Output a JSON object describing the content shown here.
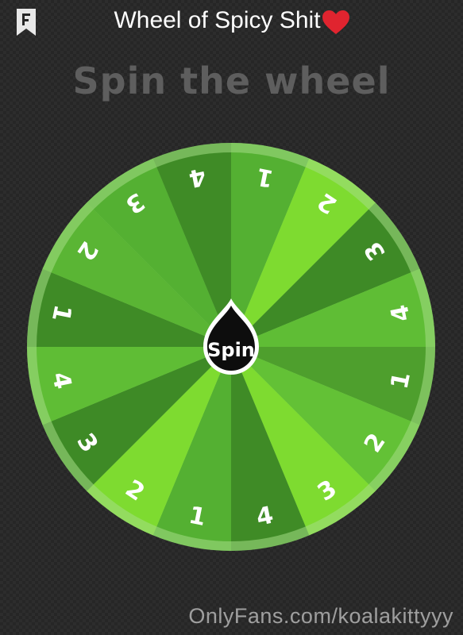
{
  "header": {
    "title": "Wheel of Spicy Shit",
    "title_emoji_icon": "red-heart-icon",
    "bookmark_icon": "bookmark-f-icon"
  },
  "subtitle": "Spin the wheel",
  "wheel": {
    "spin_label": "Spin",
    "segments": [
      {
        "label": "1",
        "color": "#54b032"
      },
      {
        "label": "2",
        "color": "#7edb30"
      },
      {
        "label": "3",
        "color": "#3e8a26"
      },
      {
        "label": "4",
        "color": "#5fbd35"
      },
      {
        "label": "1",
        "color": "#4e9f2d"
      },
      {
        "label": "2",
        "color": "#63c136"
      },
      {
        "label": "3",
        "color": "#7edb30"
      },
      {
        "label": "4",
        "color": "#3f8b26"
      },
      {
        "label": "1",
        "color": "#54b032"
      },
      {
        "label": "2",
        "color": "#7edb30"
      },
      {
        "label": "3",
        "color": "#3e8a26"
      },
      {
        "label": "4",
        "color": "#5fbd35"
      },
      {
        "label": "1",
        "color": "#3f8b26"
      },
      {
        "label": "2",
        "color": "#5ab534"
      },
      {
        "label": "3",
        "color": "#54b032"
      },
      {
        "label": "4",
        "color": "#3f8b26"
      }
    ],
    "rim_color": "#a5dd86",
    "label_color": "#ffffff",
    "spin_button_color": "#0d0d0d"
  },
  "watermark": "OnlyFans.com/koalakittyyy"
}
